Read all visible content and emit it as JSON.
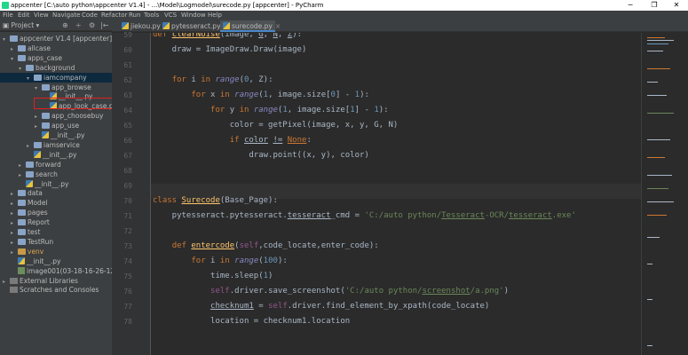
{
  "window": {
    "title": "appcenter [C:\\auto python\\appcenter V1.4] - ...\\Model\\Logmodel\\surecode.py [appcenter] - PyCharm",
    "minimize": "─",
    "maximize": "❐",
    "close": "✕"
  },
  "menu": [
    "File",
    "Edit",
    "View",
    "Navigate",
    "Code",
    "Refactor",
    "Run",
    "Tools",
    "VCS",
    "Window",
    "Help"
  ],
  "sidebar": {
    "title": "Project ▾",
    "icons": [
      "⊕",
      "÷",
      "⚙",
      "|←"
    ]
  },
  "tabs": [
    {
      "label": "jiekou.py",
      "active": false
    },
    {
      "label": "pytesseract.py",
      "active": false
    },
    {
      "label": "surecode.py",
      "active": true
    }
  ],
  "tree": [
    {
      "label": "appcenter V1.4 [appcenter]",
      "suffix": " C:\\auto",
      "depth": 0,
      "arrow": "▾",
      "type": "folder"
    },
    {
      "label": "allcase",
      "depth": 1,
      "arrow": "▸",
      "type": "folder"
    },
    {
      "label": "apps_case",
      "depth": 1,
      "arrow": "▾",
      "type": "folder"
    },
    {
      "label": "background",
      "depth": 2,
      "arrow": "▾",
      "type": "folder"
    },
    {
      "label": "iamcompany",
      "depth": 3,
      "arrow": "▾",
      "type": "folder",
      "selected": true
    },
    {
      "label": "app_browse",
      "depth": 4,
      "arrow": "▾",
      "type": "folder"
    },
    {
      "label": "__init__.py",
      "depth": 5,
      "arrow": "",
      "type": "py"
    },
    {
      "label": "app_look_case.py",
      "depth": 5,
      "arrow": "",
      "type": "py"
    },
    {
      "label": "app_choosebuy",
      "depth": 4,
      "arrow": "▸",
      "type": "folder"
    },
    {
      "label": "app_use",
      "depth": 4,
      "arrow": "▸",
      "type": "folder"
    },
    {
      "label": "__init__.py",
      "depth": 4,
      "arrow": "",
      "type": "py"
    },
    {
      "label": "iamservice",
      "depth": 3,
      "arrow": "▸",
      "type": "folder"
    },
    {
      "label": "__init__.py",
      "depth": 3,
      "arrow": "",
      "type": "py"
    },
    {
      "label": "forward",
      "depth": 2,
      "arrow": "▸",
      "type": "folder"
    },
    {
      "label": "search",
      "depth": 2,
      "arrow": "▸",
      "type": "folder"
    },
    {
      "label": "__init__.py",
      "depth": 2,
      "arrow": "",
      "type": "py"
    },
    {
      "label": "data",
      "depth": 1,
      "arrow": "▸",
      "type": "folder"
    },
    {
      "label": "Model",
      "depth": 1,
      "arrow": "▸",
      "type": "folder"
    },
    {
      "label": "pages",
      "depth": 1,
      "arrow": "▸",
      "type": "folder"
    },
    {
      "label": "Report",
      "depth": 1,
      "arrow": "▸",
      "type": "folder"
    },
    {
      "label": "test",
      "depth": 1,
      "arrow": "▸",
      "type": "folder"
    },
    {
      "label": "TestRun",
      "depth": 1,
      "arrow": "▸",
      "type": "folder"
    },
    {
      "label": "venv",
      "depth": 1,
      "arrow": "▸",
      "type": "venv"
    },
    {
      "label": "__init__.py",
      "depth": 1,
      "arrow": "",
      "type": "py"
    },
    {
      "label": "image001(03-18-16-26-12).png",
      "depth": 1,
      "arrow": "",
      "type": "img"
    },
    {
      "label": "External Libraries",
      "depth": 0,
      "arrow": "▸",
      "type": "lib"
    },
    {
      "label": "Scratches and Consoles",
      "depth": 0,
      "arrow": "",
      "type": "lib"
    }
  ],
  "line_numbers": [
    "59",
    "60",
    "61",
    "62",
    "63",
    "64",
    "65",
    "66",
    "67",
    "68",
    "69",
    "70",
    "71",
    "72",
    "73",
    "74",
    "75",
    "76",
    "77",
    "78"
  ],
  "code": [
    "<span class=\"k\">def</span> <span class=\"fn\">clearNoise</span>(image, <span class=\"u\">G</span>, <span class=\"u\">N</span>, <span class=\"u\">Z</span>):",
    "    draw = ImageDraw.Draw(image)",
    "",
    "    <span class=\"k\">for</span> i <span class=\"k\">in</span> <span class=\"it\">range</span>(<span class=\"n\">0</span>, Z):",
    "        <span class=\"k\">for</span> x <span class=\"k\">in</span> <span class=\"it\">range</span>(<span class=\"n\">1</span>, image.size[<span class=\"n\">0</span>] - <span class=\"n\">1</span>):",
    "            <span class=\"k\">for</span> y <span class=\"k\">in</span> <span class=\"it\">range</span>(<span class=\"n\">1</span>, image.size[<span class=\"n\">1</span>] - <span class=\"n\">1</span>):",
    "                color = getPixel(image, x, y, G, N)",
    "                <span class=\"k\">if</span> <span class=\"u\">color</span> <span class=\"u\">!=</span> <span class=\"k u\">None</span>:",
    "                    draw.point((x, y), color)",
    "",
    "",
    "<span class=\"k\">class</span> <span class=\"cl\">Surecode</span>(Base_Page):",
    "    pytesseract.pytesseract.<span class=\"u\">tesseract</span>_cmd = <span class=\"s\">'C:/auto python/<span class=\"u\">Tesseract</span>-OCR/<span class=\"u\">tesseract</span>.exe'</span>",
    "",
    "    <span class=\"k\">def</span> <span class=\"fn\">entercode</span>(<span class=\"slf\">self</span>,code_locate,enter_code):",
    "        <span class=\"k\">for</span> i <span class=\"k\">in</span> <span class=\"it\">range</span>(<span class=\"n\">100</span>):",
    "            time.sleep(<span class=\"n\">1</span>)",
    "            <span class=\"slf\">self</span>.driver.save_screenshot(<span class=\"s\">'C:/auto python/<span class=\"u\">screenshot</span>/a.png'</span>)",
    "            <span class=\"u\">checknum1</span> = <span class=\"slf\">self</span>.driver.find_element_by_xpath(code_locate)",
    "            location = checknum1.location"
  ]
}
